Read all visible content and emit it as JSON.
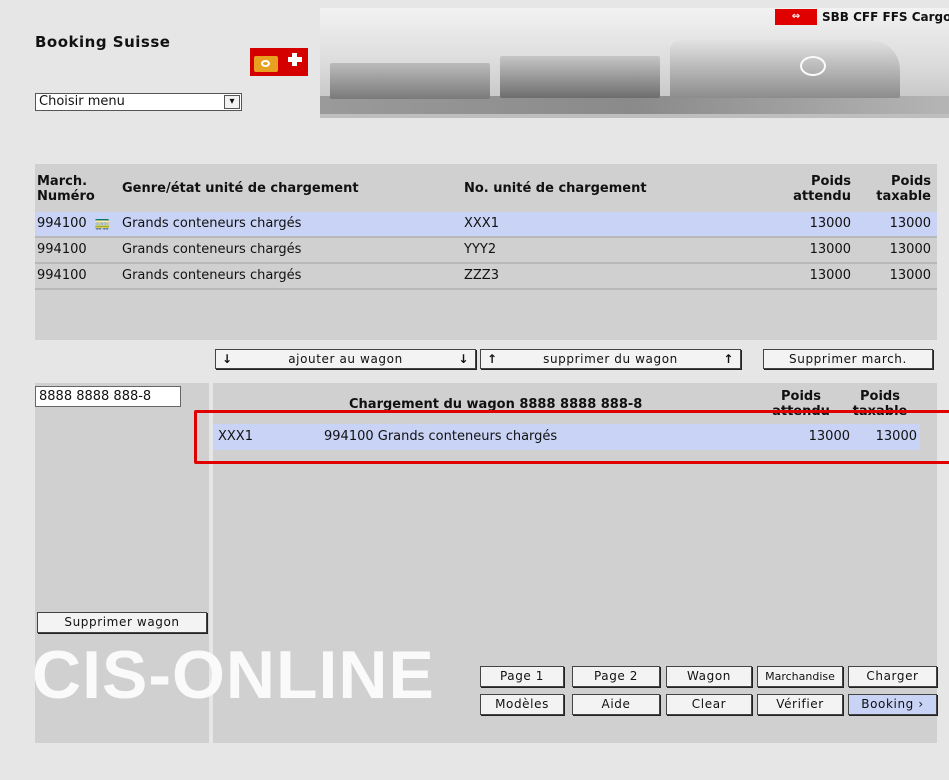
{
  "app": {
    "title": "Booking Suisse",
    "brand": "SBB CFF FFS Cargo",
    "footer_logo": "CIS-ONLINE"
  },
  "menu": {
    "selected": "Choisir menu",
    "icon": "chevron-down-icon"
  },
  "goods_table": {
    "headers": {
      "march": "March.",
      "numero": "Numéro",
      "genre": "Genre/état unité de chargement",
      "unite": "No. unité de chargement",
      "poids_attendu_1": "Poids",
      "poids_attendu_2": "attendu",
      "poids_taxable_1": "Poids",
      "poids_taxable_2": "taxable"
    },
    "rows": [
      {
        "march": "994100",
        "genre": "Grands conteneurs chargés",
        "unite": "XXX1",
        "attendu": "13000",
        "taxable": "13000",
        "selected": true,
        "icon": "wagon-icon"
      },
      {
        "march": "994100",
        "genre": "Grands conteneurs chargés",
        "unite": "YYY2",
        "attendu": "13000",
        "taxable": "13000",
        "selected": false
      },
      {
        "march": "994100",
        "genre": "Grands conteneurs chargés",
        "unite": "ZZZ3",
        "attendu": "13000",
        "taxable": "13000",
        "selected": false
      }
    ]
  },
  "actions": {
    "add": "ajouter au wagon",
    "remove": "supprimer du wagon",
    "delete_goods": "Supprimer march.",
    "down_arrow": "↓",
    "up_arrow": "↑"
  },
  "wagon": {
    "number": "8888 8888 888-8",
    "title": "Chargement du wagon 8888 8888 888-8",
    "headers": {
      "attendu_1": "Poids",
      "attendu_2": "attendu",
      "taxable_1": "Poids",
      "taxable_2": "taxable"
    },
    "load": {
      "unit": "XXX1",
      "desc": "994100 Grands conteneurs chargés",
      "attendu": "13000",
      "taxable": "13000"
    },
    "delete": "Supprimer wagon"
  },
  "nav": {
    "row1": [
      "Page 1",
      "Page 2",
      "Wagon",
      "Marchandise",
      "Charger"
    ],
    "row2": [
      "Modèles",
      "Aide",
      "Clear",
      "Vérifier",
      "Booking ›"
    ]
  },
  "colors": {
    "selection": "#c8d3f5",
    "panel": "#d0d0d0",
    "highlight": "#e00000"
  }
}
